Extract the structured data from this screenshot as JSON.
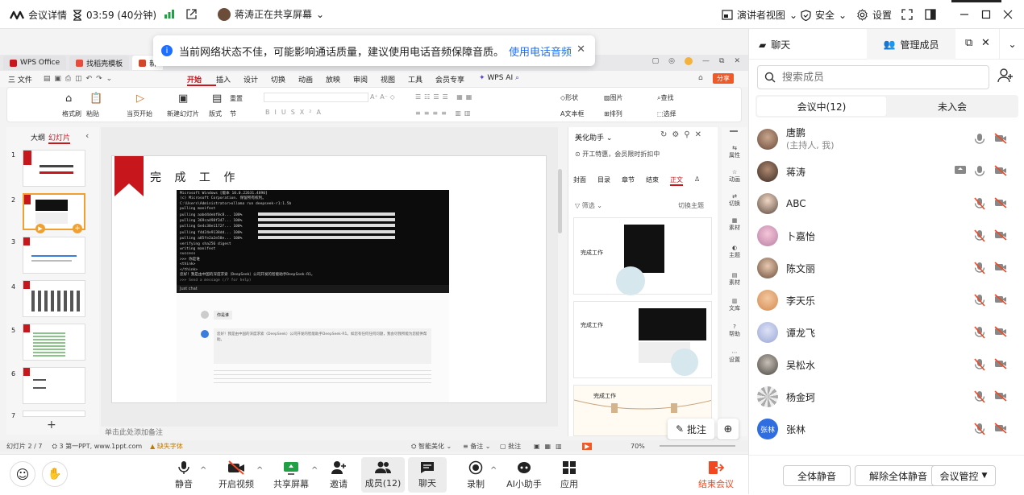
{
  "topbar": {
    "meeting_details": "会议详情",
    "timer": "03:59 (40分钟)",
    "sharer": "蒋涛正在共享屏幕",
    "speaker_view": "演讲者视图",
    "security": "安全",
    "settings": "设置"
  },
  "banner": {
    "message": "当前网络状态不佳，可能影响通话质量，建议使用电话音频保障音质。",
    "link": "使用电话音频"
  },
  "wps": {
    "tabs": [
      "WPS Office",
      "找稻壳模板",
      "新"
    ],
    "menu_left": "三 文件",
    "menu": [
      "开始",
      "插入",
      "设计",
      "切换",
      "动画",
      "放映",
      "审阅",
      "视图",
      "工具",
      "会员专享"
    ],
    "wps_ai": "WPS AI",
    "share_btn": "分享",
    "ribbon": {
      "format_brush": "格式刷",
      "paste": "粘贴",
      "play_current": "当页开始",
      "new_slide": "新建幻灯片",
      "layout": "版式",
      "section": "节",
      "reset": "重置",
      "shape": "形状",
      "picture": "图片",
      "textbox": "文本框",
      "arrange": "排列",
      "find": "查找",
      "select": "选择"
    },
    "left_tabs": [
      "大纲",
      "幻灯片"
    ],
    "slide_numbers": [
      "1",
      "2",
      "3",
      "4",
      "5",
      "6",
      "7"
    ],
    "slide_title": "完 成 工 作",
    "notes_placeholder": "单击此处添加备注",
    "status": {
      "slide_count": "幻灯片 2 / 7",
      "theme": "3 第一PPT, www.1ppt.com",
      "missing_font": "缺失字体",
      "smart_beautify": "智能美化",
      "notes": "备注",
      "comments": "批注",
      "zoom": "70%"
    },
    "beautify": {
      "title": "美化助手",
      "hint": "开工特惠，会员限时折扣中",
      "tabs": [
        "封面",
        "目录",
        "章节",
        "结束",
        "正文"
      ],
      "filter": "筛选",
      "switch_theme": "切换主题",
      "card_title": "完成工作"
    },
    "rightbar": [
      "属性",
      "动画",
      "切换",
      "素材",
      "主题",
      "素材",
      "文库",
      "帮助",
      "设置"
    ],
    "annotate": "批注",
    "terminal_lines": [
      "Microsoft Windows [版本 10.0.22631.4890]",
      "(c) Microsoft Corporation. 保留所有权利。",
      "C:\\Users\\Administrator>ollama run deepseek-r1:1.5b",
      "pulling manifest",
      "pulling aabd4debf0c8... 100%",
      "pulling 369ca498f347... 100%",
      "pulling 6e4c38e1172f... 100%",
      "pulling f4d24e9138dd... 100%",
      "pulling a85fe2a2e58e... 100%",
      "verifying sha256 digest",
      "writing manifest",
      "success",
      ">>> 你是谁",
      "<think>",
      "</think>",
      "您好！我是由中国的深度求索（DeepSeek）公司开发的智能助手DeepSeek-R1。",
      ">>> Send a message (/? for help)"
    ],
    "chat_label": "Just chat",
    "chat_user": "你是谁",
    "chat_reply": "您好！我是由中国的深度求索（DeepSeek）公司开发的智能助手DeepSeek-R1。如您有任何任何问题，我会尽我所能为您提供帮助。"
  },
  "bottombar": {
    "mute": "静音",
    "video": "开启视频",
    "share": "共享屏幕",
    "invite": "邀请",
    "members": "成员(12)",
    "chat": "聊天",
    "record": "录制",
    "ai": "AI小助手",
    "apps": "应用",
    "end": "结束会议"
  },
  "panel": {
    "tab_chat": "聊天",
    "tab_members": "管理成员",
    "search_placeholder": "搜索成员",
    "seg_in": "会议中(12)",
    "seg_out": "未入会",
    "members": [
      {
        "name": "唐鹏",
        "sub": "(主持人, 我)"
      },
      {
        "name": "蒋涛",
        "sub": ""
      },
      {
        "name": "ABC",
        "sub": ""
      },
      {
        "name": "卜嘉怡",
        "sub": ""
      },
      {
        "name": "陈文丽",
        "sub": ""
      },
      {
        "name": "李天乐",
        "sub": ""
      },
      {
        "name": "谭龙飞",
        "sub": ""
      },
      {
        "name": "吴松水",
        "sub": ""
      },
      {
        "name": "杨金珂",
        "sub": ""
      },
      {
        "name": "张林",
        "sub": ""
      }
    ],
    "avatar_text_zhanglin": "张林",
    "mute_all": "全体静音",
    "unmute_all": "解除全体静音",
    "control": "会议管控"
  },
  "colors": {
    "accent": "#1e6fff",
    "danger": "#f24822",
    "wps_red": "#c8161d"
  }
}
